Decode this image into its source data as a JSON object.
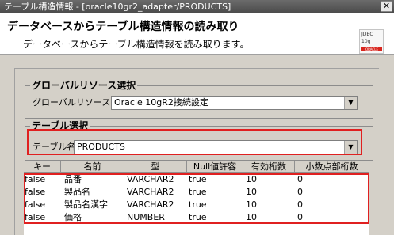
{
  "window": {
    "title": "テーブル構造情報 - [oracle10gr2_adapter/PRODUCTS]",
    "close_glyph": "✕"
  },
  "header": {
    "title": "データベースからテーブル構造情報の読み取り",
    "description": "データベースからテーブル構造情報を読み取ります。",
    "logo_lines": [
      "JDBC",
      "10g",
      "ORACLE"
    ]
  },
  "global_resource": {
    "group_title": "グローバルリソース選択",
    "label": "グローバルリソース名",
    "value": "Oracle 10gR2接続設定"
  },
  "table_select": {
    "group_title": "テーブル選択",
    "label": "テーブル名",
    "value": "PRODUCTS"
  },
  "columns_table": {
    "headers": [
      "キー",
      "名前",
      "型",
      "Null値許容",
      "有効桁数",
      "小数点部桁数"
    ],
    "rows": [
      [
        "false",
        "品番",
        "VARCHAR2",
        "true",
        "10",
        "0"
      ],
      [
        "false",
        "製品名",
        "VARCHAR2",
        "true",
        "10",
        "0"
      ],
      [
        "false",
        "製品名漢字",
        "VARCHAR2",
        "true",
        "10",
        "0"
      ],
      [
        "false",
        "価格",
        "NUMBER",
        "true",
        "10",
        "0"
      ]
    ]
  },
  "colors": {
    "highlight": "#e02020",
    "dialog_bg": "#d4d0c8",
    "titlebar": "#4a4a4a"
  }
}
